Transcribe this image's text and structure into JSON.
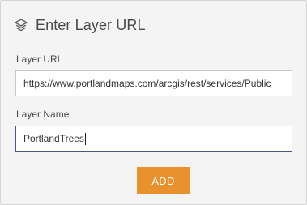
{
  "header": {
    "icon": "layers-icon",
    "title": "Enter Layer URL"
  },
  "form": {
    "url_label": "Layer URL",
    "url_value": "https://www.portlandmaps.com/arcgis/rest/services/Public",
    "name_label": "Layer Name",
    "name_value": "PortlandTrees"
  },
  "actions": {
    "add_label": "ADD",
    "add_color": "#e8912d"
  }
}
